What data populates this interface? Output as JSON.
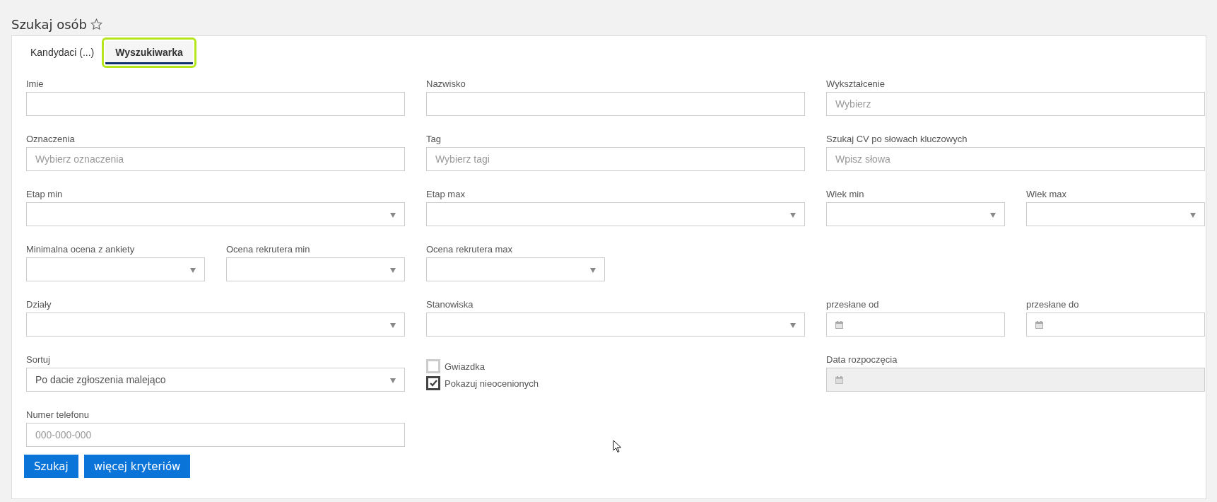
{
  "page": {
    "title": "Szukaj osób"
  },
  "tabs": [
    {
      "label": "Kandydaci (...)",
      "selected": false
    },
    {
      "label": "Wyszukiwarka",
      "selected": true
    }
  ],
  "fields": [
    {
      "kind": "text",
      "label": "Imie"
    },
    {
      "kind": "text",
      "label": "Nazwisko"
    },
    {
      "kind": "text",
      "label": "Wykształcenie",
      "placeholder": "Wybierz"
    },
    {
      "kind": "text",
      "label": "Oznaczenia",
      "placeholder": "Wybierz oznaczenia"
    },
    {
      "kind": "text",
      "label": "Tag",
      "placeholder": "Wybierz tagi"
    },
    {
      "kind": "text",
      "label": "Szukaj CV po słowach kluczowych",
      "placeholder": "Wpisz słowa"
    },
    {
      "kind": "select",
      "label": "Etap min"
    },
    {
      "kind": "select",
      "label": "Etap max"
    },
    {
      "kind": "select",
      "label": "Wiek min"
    },
    {
      "kind": "select",
      "label": "Wiek max"
    },
    {
      "kind": "select",
      "label": "Minimalna ocena z ankiety"
    },
    {
      "kind": "select",
      "label": "Ocena rekrutera min"
    },
    {
      "kind": "select",
      "label": "Ocena rekrutera max"
    },
    {
      "kind": "select",
      "label": "Działy"
    },
    {
      "kind": "select",
      "label": "Stanowiska"
    },
    {
      "kind": "date",
      "label": "przesłane od",
      "disabled": false
    },
    {
      "kind": "date",
      "label": "przesłane do",
      "disabled": false
    },
    {
      "kind": "select",
      "label": "Sortuj",
      "value": "Po dacie zgłoszenia malejąco"
    },
    {
      "kind": "checks",
      "items": [
        {
          "label": "Gwiazdka",
          "checked": false
        },
        {
          "label": "Pokazuj nieocenionych",
          "checked": true
        }
      ]
    },
    {
      "kind": "date",
      "label": "Data rozpoczęcia",
      "disabled": true
    },
    {
      "kind": "text",
      "label": "Numer telefonu",
      "placeholder": "000-000-000"
    }
  ],
  "buttons": [
    "Szukaj",
    "więcej kryteriów"
  ]
}
